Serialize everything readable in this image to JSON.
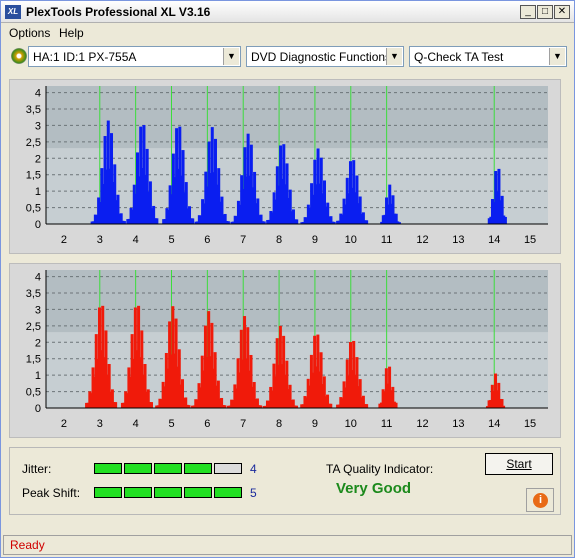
{
  "window": {
    "app_icon": "XL",
    "title": "PlexTools Professional XL V3.16",
    "buttons": [
      "_",
      "□",
      "✕"
    ]
  },
  "menu": {
    "items": [
      "Options",
      "Help"
    ]
  },
  "toolbar": {
    "drive_icon": "disc-drive-icon",
    "drive": "HA:1 ID:1  PX-755A",
    "function": "DVD Diagnostic Functions",
    "test": "Q-Check TA Test"
  },
  "charts": {
    "y_ticks": [
      "0",
      "0,5",
      "1",
      "1,5",
      "2",
      "2,5",
      "3",
      "3,5",
      "4"
    ],
    "x_ticks": [
      "2",
      "3",
      "4",
      "5",
      "6",
      "7",
      "8",
      "9",
      "10",
      "11",
      "12",
      "13",
      "14",
      "15"
    ],
    "marker_color": "#3cdc3c"
  },
  "chart_data": [
    {
      "type": "bar",
      "color": "#0a1ef0",
      "x_range": [
        1.5,
        15.5
      ],
      "ylim": [
        0,
        4.2
      ],
      "x_ticks": [
        2,
        3,
        4,
        5,
        6,
        7,
        8,
        9,
        10,
        11,
        12,
        13,
        14,
        15
      ],
      "markers": [
        3,
        4,
        5,
        6,
        7,
        8,
        9,
        10,
        11,
        14
      ],
      "peaks": [
        {
          "center": 3.2,
          "height": 3.15
        },
        {
          "center": 4.15,
          "height": 3.1
        },
        {
          "center": 5.15,
          "height": 3.05
        },
        {
          "center": 6.1,
          "height": 2.95
        },
        {
          "center": 7.1,
          "height": 2.75
        },
        {
          "center": 8.05,
          "height": 2.5
        },
        {
          "center": 9.05,
          "height": 2.3
        },
        {
          "center": 10.0,
          "height": 2.0
        },
        {
          "center": 11.05,
          "height": 1.2
        },
        {
          "center": 14.05,
          "height": 1.8
        }
      ]
    },
    {
      "type": "bar",
      "color": "#f01a0a",
      "x_range": [
        1.5,
        15.5
      ],
      "ylim": [
        0,
        4.2
      ],
      "x_ticks": [
        2,
        3,
        4,
        5,
        6,
        7,
        8,
        9,
        10,
        11,
        12,
        13,
        14,
        15
      ],
      "markers": [
        3,
        4,
        5,
        6,
        7,
        8,
        9,
        10,
        11,
        14
      ],
      "peaks": [
        {
          "center": 3.0,
          "height": 3.2
        },
        {
          "center": 4.0,
          "height": 3.2
        },
        {
          "center": 5.0,
          "height": 3.1
        },
        {
          "center": 6.0,
          "height": 2.95
        },
        {
          "center": 7.0,
          "height": 2.8
        },
        {
          "center": 8.0,
          "height": 2.5
        },
        {
          "center": 9.0,
          "height": 2.3
        },
        {
          "center": 10.0,
          "height": 2.1
        },
        {
          "center": 11.0,
          "height": 1.35
        },
        {
          "center": 14.0,
          "height": 1.05
        }
      ]
    }
  ],
  "results": {
    "jitter_label": "Jitter:",
    "jitter_value": "4",
    "jitter_level": 4,
    "peak_shift_label": "Peak Shift:",
    "peak_shift_value": "5",
    "peak_shift_level": 5,
    "segments_total": 5,
    "segment_on_color": "#22e022",
    "segment_off_color": "#dcdcdc",
    "ta_label": "TA Quality Indicator:",
    "ta_value": "Very Good",
    "start_label": "Start",
    "info_icon": "info-icon"
  },
  "status": {
    "text": "Ready"
  }
}
